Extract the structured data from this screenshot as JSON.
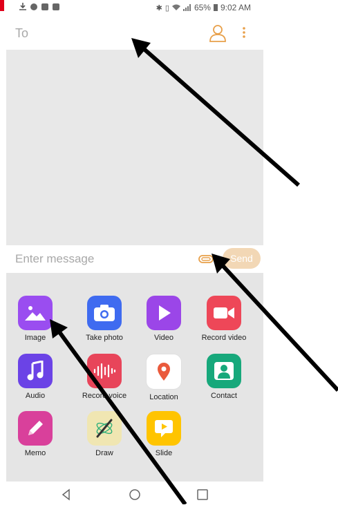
{
  "status_bar": {
    "battery": "65%",
    "time": "9:02 AM"
  },
  "header": {
    "to_label": "To"
  },
  "compose": {
    "placeholder": "Enter message",
    "send_label": "Send"
  },
  "attachments": {
    "items": [
      {
        "label": "Image"
      },
      {
        "label": "Take photo"
      },
      {
        "label": "Video"
      },
      {
        "label": "Record video"
      },
      {
        "label": "Audio"
      },
      {
        "label": "Record voice"
      },
      {
        "label": "Location"
      },
      {
        "label": "Contact"
      },
      {
        "label": "Memo"
      },
      {
        "label": "Draw"
      },
      {
        "label": "Slide"
      }
    ]
  },
  "colors": {
    "accent": "#e8a04a",
    "send_bg": "#f2d7b5",
    "image": "#9a4df0",
    "camera": "#3f6bf0",
    "video": "#9b46e8",
    "record_video": "#ee4758",
    "audio": "#6b43e6",
    "record_voice": "#e8455a",
    "location": "#ffffff",
    "contact": "#17a87b",
    "memo": "#d9409b",
    "draw": "#f0e6b2",
    "slide": "#ffc400"
  }
}
